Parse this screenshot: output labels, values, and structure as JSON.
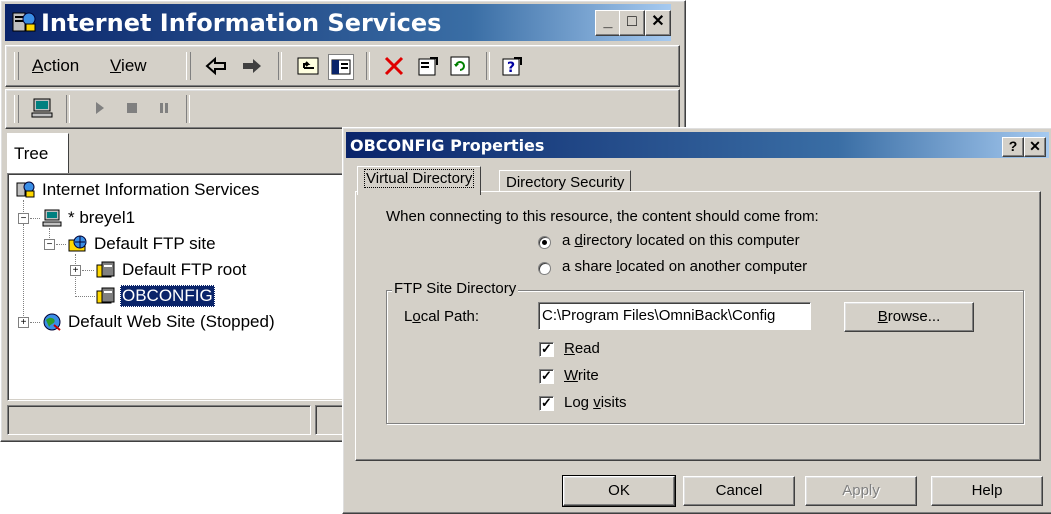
{
  "iis_window": {
    "title": "Internet Information Services",
    "controls": {
      "minimize": "_",
      "maximize": "□",
      "close": "✕"
    },
    "menu": {
      "action": {
        "pre": "",
        "key": "A",
        "post": "ction"
      },
      "view": {
        "pre": "",
        "key": "V",
        "post": "iew"
      }
    },
    "tree_tab_label": "Tree",
    "tree": {
      "root": "Internet Information Services",
      "server": "* breyel1",
      "ftp_site": "Default FTP site",
      "ftp_root": "Default FTP root",
      "obconfig": "OBCONFIG",
      "web_site": "Default Web Site (Stopped)"
    },
    "expander_plus": "+",
    "expander_minus": "−"
  },
  "dialog": {
    "title": "OBCONFIG Properties",
    "help_btn": "?",
    "close_btn": "✕",
    "tabs": [
      "Virtual Directory",
      "Directory Security"
    ],
    "prompt": "When connecting to this resource, the content should come from:",
    "radio_local": {
      "pre": "a ",
      "key": "d",
      "post": "irectory located on this computer"
    },
    "radio_share": {
      "pre": "a share ",
      "key": "l",
      "post": "ocated on another computer"
    },
    "group_label": "FTP Site Directory",
    "local_path_label": {
      "pre": "L",
      "key": "o",
      "post": "cal Path:"
    },
    "local_path_value": "C:\\Program Files\\OmniBack\\Config",
    "browse": {
      "pre": "",
      "key": "B",
      "post": "rowse..."
    },
    "read": {
      "pre": "",
      "key": "R",
      "post": "ead"
    },
    "write": {
      "pre": "",
      "key": "W",
      "post": "rite"
    },
    "log_visits": {
      "pre": "Log ",
      "key": "v",
      "post": "isits"
    },
    "checkmark": "✓",
    "buttons": {
      "ok": "OK",
      "cancel": "Cancel",
      "apply": "Apply",
      "help": "Help"
    }
  },
  "colors": {
    "titlebar_start": "#0a246a",
    "titlebar_end": "#a6caf0",
    "face": "#d4d0c8",
    "selection": "#0a246a"
  }
}
